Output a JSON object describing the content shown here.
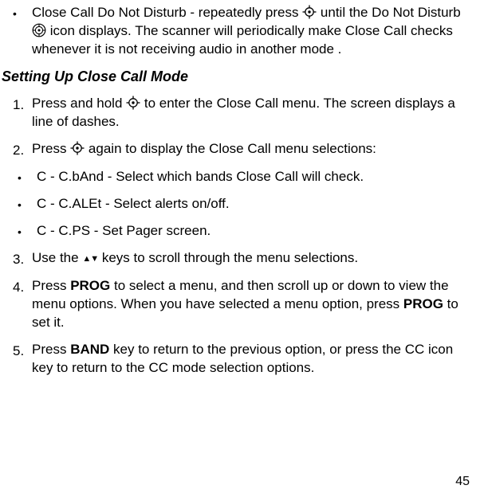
{
  "bullet_intro": {
    "pre": "Close Call Do Not Disturb -  repeatedly press ",
    "mid": " until the Do Not Disturb ",
    "post": " icon displays. The scanner will periodically make Close Call checks whenever it is not receiving audio in another mode ."
  },
  "heading": "Setting Up Close Call Mode",
  "steps": {
    "s1": {
      "num": "1.",
      "pre": "Press and hold  ",
      "post": " to enter the Close Call menu. The screen displays a line of dashes."
    },
    "s2": {
      "num": "2.",
      "pre": "Press  ",
      "post": "  again to display the Close Call menu selections:"
    },
    "sub": [
      "C - C.bAnd - Select which bands Close Call will check.",
      "C - C.ALEt - Select alerts on/off.",
      "C - C.PS - Set Pager screen."
    ],
    "s3": {
      "num": "3.",
      "pre": "Use the ",
      "post": " keys to scroll through the menu selections."
    },
    "s4": {
      "num": "4.",
      "a": "Press ",
      "b": "PROG",
      "c": " to select a menu, and then scroll up or down to view the menu options. When you have selected a menu option, press ",
      "d": "PROG",
      "e": " to set it."
    },
    "s5": {
      "num": "5.",
      "a": "Press ",
      "b": "BAND",
      "c": " key to return to the previous option, or press the CC icon key to return to the CC mode selection options."
    }
  },
  "icons": {
    "cc_target_name": "close-call-icon",
    "cc_dnd_name": "close-call-dnd-icon",
    "arrows_name": "up-down-arrows-icon"
  },
  "page_number": "45"
}
